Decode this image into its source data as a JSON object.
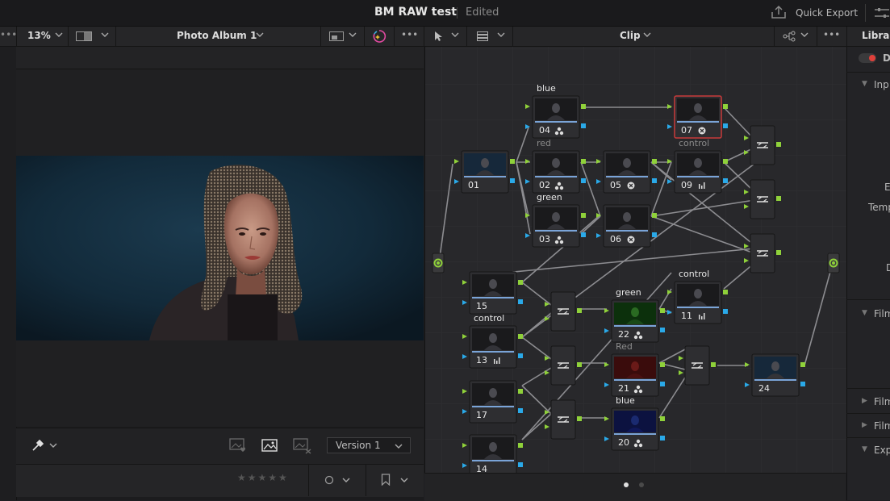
{
  "app": {
    "title": "BM RAW test",
    "status": "Edited",
    "quick_export_label": "Quick Export"
  },
  "toolbar": {
    "zoom": "13%",
    "album": "Photo Album 1",
    "graph_mode": "Clip",
    "inspector_tab": "Library"
  },
  "viewer": {
    "version_label": "Version 1",
    "rating_stars": 0
  },
  "inspector": {
    "items": [
      "D",
      "Inp",
      "E",
      "Temp",
      "D",
      "Film",
      "Film",
      "Film",
      "Exp"
    ]
  },
  "nodes": [
    {
      "id": "01",
      "label": "",
      "badge": ""
    },
    {
      "id": "02",
      "label": "red",
      "badge": "fx"
    },
    {
      "id": "03",
      "label": "green",
      "badge": "fx"
    },
    {
      "id": "04",
      "label": "blue",
      "badge": "fx"
    },
    {
      "id": "05",
      "label": "",
      "badge": "ofx"
    },
    {
      "id": "06",
      "label": "",
      "badge": "ofx"
    },
    {
      "id": "07",
      "label": "",
      "badge": "ofx"
    },
    {
      "id": "09",
      "label": "control",
      "badge": "bars"
    },
    {
      "id": "11",
      "label": "control",
      "badge": "bars"
    },
    {
      "id": "13",
      "label": "control",
      "badge": "bars"
    },
    {
      "id": "14",
      "label": "",
      "badge": ""
    },
    {
      "id": "15",
      "label": "",
      "badge": ""
    },
    {
      "id": "17",
      "label": "",
      "badge": ""
    },
    {
      "id": "20",
      "label": "blue",
      "badge": "fx"
    },
    {
      "id": "21",
      "label": "Red",
      "badge": "fx"
    },
    {
      "id": "22",
      "label": "green",
      "badge": "fx"
    },
    {
      "id": "24",
      "label": "",
      "badge": ""
    }
  ],
  "colors": {
    "accent_green": "#8fd13a",
    "port_blue": "#2aa9e8",
    "selected_node": "#c83a3a",
    "record_red": "#e0403a"
  }
}
